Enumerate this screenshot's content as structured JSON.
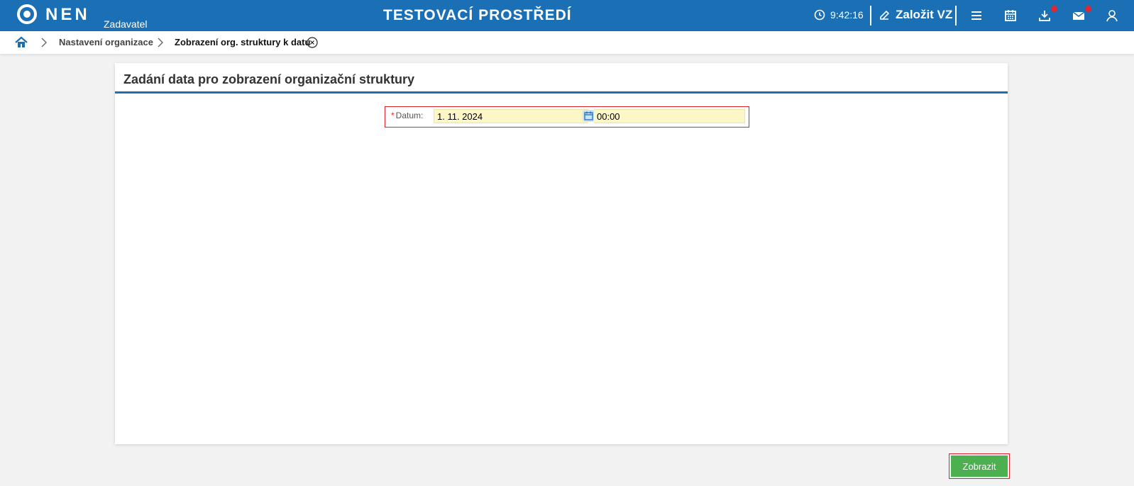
{
  "header": {
    "logo_text": "NEN",
    "logo_sub": "Zadavatel",
    "environment": "TESTOVACÍ PROSTŘEDÍ",
    "time": "9:42:16",
    "create_label": "Založit VZ",
    "icons": [
      "clock-icon",
      "edit-icon",
      "menu-icon",
      "calendar-icon",
      "download-icon",
      "mail-icon",
      "user-icon"
    ]
  },
  "breadcrumb": {
    "items": [
      "Nastavení organizace",
      "Zobrazení org. struktury k datu"
    ]
  },
  "panel": {
    "title": "Zadání data pro zobrazení organizační struktury"
  },
  "form": {
    "date_label": "Datum:",
    "date_value": "1. 11. 2024",
    "time_value": "00:00"
  },
  "actions": {
    "submit_label": "Zobrazit"
  },
  "colors": {
    "header_bg": "#1a6fb5",
    "submit_bg": "#4caf50",
    "input_bg": "#fdf7c7",
    "error_border": "#e0232b"
  }
}
